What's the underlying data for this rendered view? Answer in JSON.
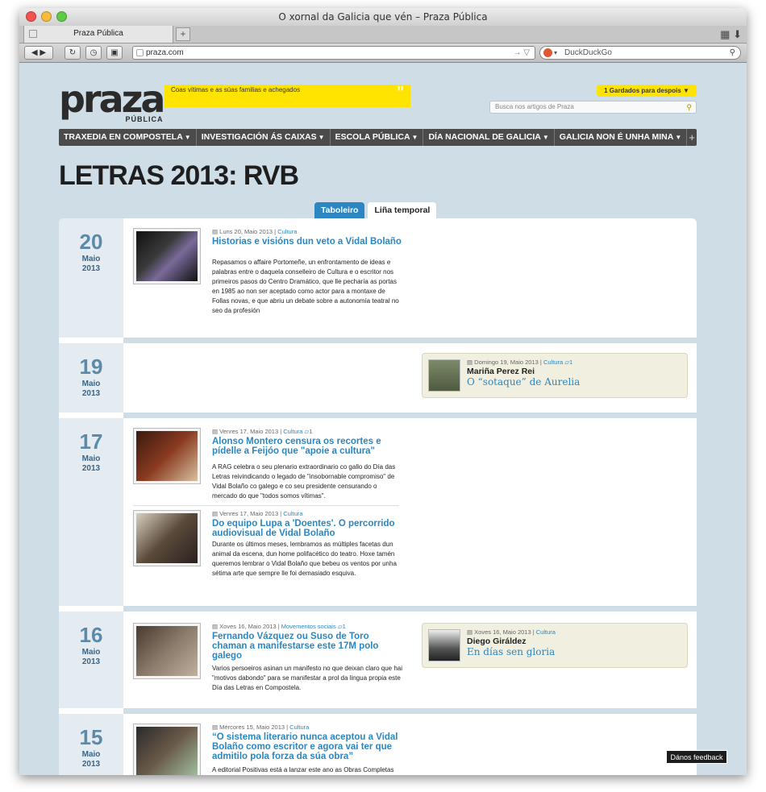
{
  "browser": {
    "window_title": "O xornal da Galicia que vén – Praza Pública",
    "tab_label": "Praza Pública",
    "new_tab_label": "+",
    "address": "praza.com",
    "search_engine_placeholder": "DuckDuckGo"
  },
  "site": {
    "logo_word": "praza",
    "logo_sub": "PÚBLICA",
    "ticker_text": "Coas vítimas e as súas familias e achegados",
    "saved_label": "1  Gardados para despois ▼",
    "search_placeholder": "Busca nos artigos de Praza",
    "nav": [
      {
        "label": "TRAXEDIA EN COMPOSTELA"
      },
      {
        "label": "INVESTIGACIÓN ÁS CAIXAS"
      },
      {
        "label": "ESCOLA PÚBLICA"
      },
      {
        "label": "DÍA NACIONAL DE GALICIA"
      },
      {
        "label": "GALICIA NON É UNHA MINA"
      }
    ],
    "nav_more": "+",
    "page_title": "LETRAS 2013: RVB",
    "view_tabs": {
      "active": "Taboleiro",
      "inactive": "Liña temporal"
    },
    "feedback": "Dános feedback"
  },
  "timeline": {
    "days": [
      {
        "day": "20",
        "month": "Maio",
        "year": "2013",
        "articles": [
          {
            "date": "Luns 20, Maio 2013 |",
            "category": "Cultura",
            "comments": "",
            "title": "Historias e visións dun veto a Vidal Bolaño",
            "body": "Repasamos o affaire Portomeñe, un enfrontamento de ideas e palabras entre o daquela conselleiro de Cultura e o escritor nos primeiros pasos do Centro Dramático, que lle pecharía as portas en 1985 ao non ser aceptado como actor para a montaxe de Follas novas, e que abriu un debate sobre a autonomía teatral no seo da profesión"
          }
        ]
      },
      {
        "day": "19",
        "month": "Maio",
        "year": "2013",
        "opinion": {
          "date": "Domingo 19, Maio 2013 |",
          "category": "Cultura",
          "comments": "1",
          "author": "Mariña Perez Rei",
          "title": "O “sotaque” de Aurelia"
        }
      },
      {
        "day": "17",
        "month": "Maio",
        "year": "2013",
        "articles": [
          {
            "date": "Venres 17, Maio 2013 |",
            "category": "Cultura",
            "comments": "1",
            "title": "Alonso Montero censura os recortes e pídelle a Feijóo que \"apoie a cultura\"",
            "body": "A RAG celebra o seu plenario extraordinario co gallo do Día das Letras reivindicando o legado de \"insobornable compromiso\" de Vidal Bolaño co galego e co seu presidente censurando o mercado do que \"todos somos vítimas\"."
          },
          {
            "date": "Venres 17, Maio 2013 |",
            "category": "Cultura",
            "comments": "",
            "title": "Do equipo Lupa a 'Doentes'. O percorrido audiovisual de Vidal Bolaño",
            "body": "Durante os últimos meses, lembramos as múltiples facetas dun animal da escena, dun home polifacético do teatro. Hoxe tamén queremos lembrar o Vidal Bolaño que bebeu os ventos por unha sétima arte que sempre lle foi demasiado esquiva."
          }
        ]
      },
      {
        "day": "16",
        "month": "Maio",
        "year": "2013",
        "articles": [
          {
            "date": "Xoves 16, Maio 2013 |",
            "category": "Movementos sociais",
            "comments": "1",
            "title": "Fernando Vázquez ou Suso de Toro chaman a manifestarse este 17M polo galego",
            "body": "Varios persoeiros asinan un manifesto no que deixan claro que  hai \"motivos dabondo\" para se manifestar a prol da lingua propia este Día das Letras en Compostela."
          }
        ],
        "opinion": {
          "date": "Xoves 16, Maio 2013 |",
          "category": "Cultura",
          "comments": "",
          "author": "Diego Giráldez",
          "title": "En días sen gloria"
        }
      },
      {
        "day": "15",
        "month": "Maio",
        "year": "2013",
        "articles": [
          {
            "date": "Mércores 15, Maio 2013 |",
            "category": "Cultura",
            "comments": "",
            "title": "“O sistema literario nunca aceptou a Vidal Bolaño como escritor e agora vai ter que admitilo pola forza da súa obra”",
            "body": "A editorial Positivas está a lanzar este ano as Obras Completas de Vidal Bolaño, un proxecto no que o pai"
          }
        ]
      }
    ]
  },
  "colors": {
    "page_bg": "#cfdde6",
    "accent": "#2b86c1",
    "ticker": "#ffe400",
    "nav_bg": "#4b4b4b"
  }
}
